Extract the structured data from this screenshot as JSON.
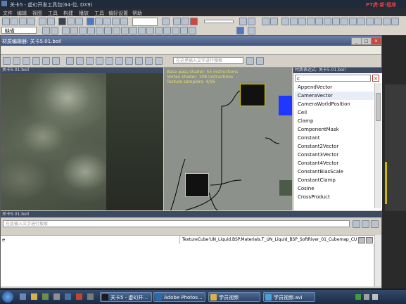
{
  "main_window": {
    "title": "关卡5 - 虚幻开发工具包(64-位, DX9)",
    "watermark": "PT虎·新·程序",
    "menu": [
      "文件",
      "编辑",
      "视图",
      "工具",
      "构建",
      "播放",
      "工具",
      "偏好设置",
      "帮助"
    ],
    "layer_label": "缺省"
  },
  "material_editor": {
    "title": "材质编辑器: 关卡5.01.boil",
    "search_placeholder": "在这里输入文字进行搜索",
    "preview_title": "关卡5.01.boil",
    "graph_info": [
      "Base pass shader: 54 instructions",
      "Vertex shader: 108 instructions",
      "Texture samplers: 4/16"
    ]
  },
  "expressions": {
    "title": "材质表达式: 关卡5.01.boil",
    "filter_value": "c",
    "items": [
      "AppendVector",
      "CameraVector",
      "CameraWorldPosition",
      "Ceil",
      "Clamp",
      "ComponentMask",
      "Constant",
      "Constant2Vector",
      "Constant3Vector",
      "Constant4Vector",
      "ConstantBiasScale",
      "ConstantClamp",
      "Cosine",
      "CrossProduct"
    ]
  },
  "properties": {
    "title": "关卡5.01.boil",
    "search_placeholder": "在此输入文字进行搜索",
    "row_label": "e",
    "row_value": "TextureCube'UN_Liquid.BSP.Materials.T_UN_Liquid_BSP_SoftRiver_01_Cubemap_CUB"
  },
  "taskbar": {
    "tasks": [
      "关卡5 - 虚幻开...",
      "Adobe Photos...",
      "学员视频",
      "学员视频.avi"
    ]
  }
}
